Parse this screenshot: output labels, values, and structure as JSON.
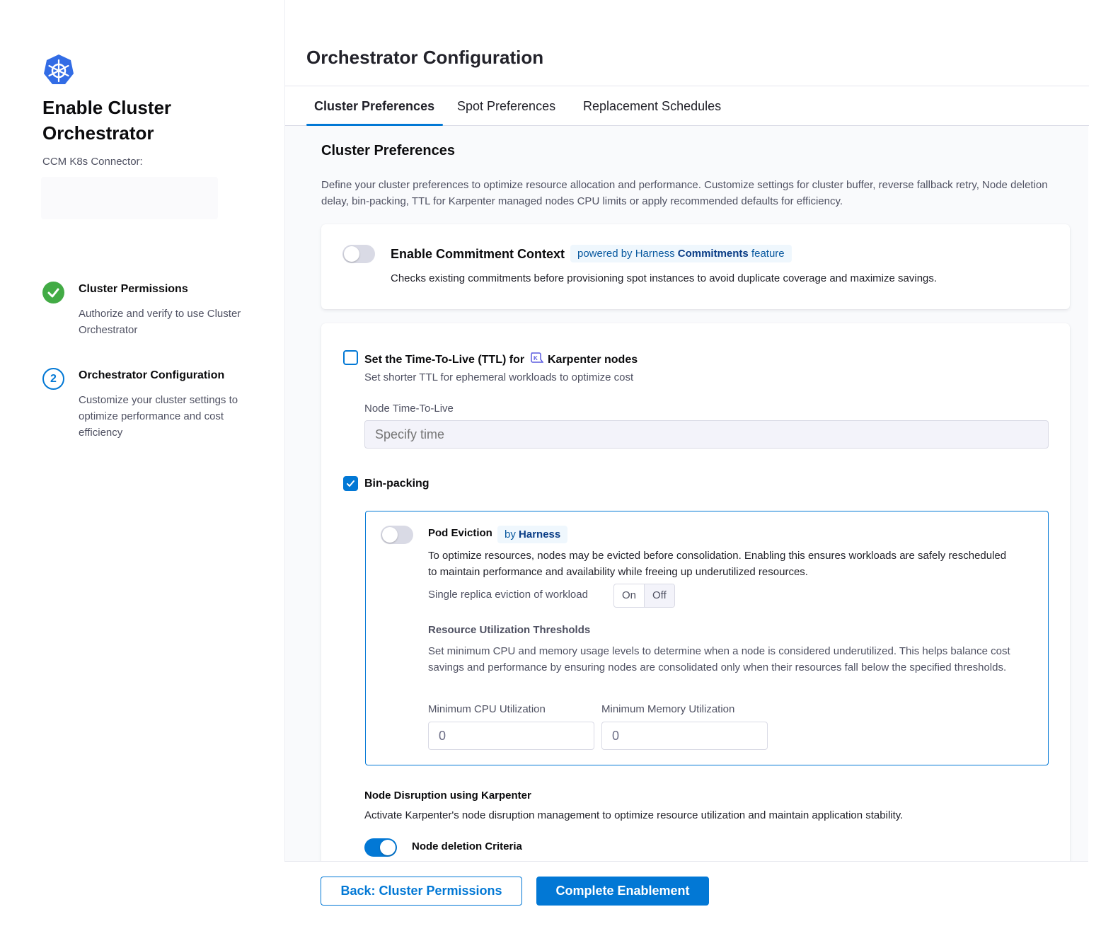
{
  "sidebar": {
    "title": "Enable Cluster Orchestrator",
    "connector_label": "CCM K8s Connector:",
    "steps": [
      {
        "number": "",
        "status": "complete",
        "title": "Cluster Permissions",
        "description": "Authorize and verify to use Cluster Orchestrator"
      },
      {
        "number": "2",
        "status": "current",
        "title": "Orchestrator Configuration",
        "description": "Customize your cluster settings to optimize performance and cost efficiency"
      }
    ]
  },
  "main": {
    "page_title": "Orchestrator Configuration",
    "tabs": [
      {
        "label": "Cluster Preferences",
        "active": true
      },
      {
        "label": "Spot Preferences",
        "active": false
      },
      {
        "label": "Replacement Schedules",
        "active": false
      }
    ],
    "section_title": "Cluster Preferences",
    "section_description": "Define your cluster preferences to optimize resource allocation and performance. Customize settings for cluster buffer, reverse fallback retry, Node deletion delay, bin-packing, TTL for Karpenter managed nodes CPU limits or apply recommended defaults for efficiency.",
    "commitment": {
      "enabled": false,
      "title": "Enable Commitment Context",
      "pill_prefix": "powered by Harness",
      "pill_bold": "Commitments",
      "pill_suffix": "feature",
      "description": "Checks existing commitments before provisioning spot instances to avoid duplicate coverage and maximize savings."
    },
    "ttl": {
      "checked": false,
      "title_prefix": "Set the Time-To-Live (TTL) for",
      "title_suffix": "Karpenter nodes",
      "description": "Set shorter TTL for ephemeral workloads to optimize cost",
      "field_label": "Node Time-To-Live",
      "placeholder": "Specify time"
    },
    "bin_packing": {
      "checked": true,
      "label": "Bin-packing",
      "pod_eviction": {
        "enabled": false,
        "title": "Pod Eviction",
        "pill_prefix": "by",
        "pill_bold": "Harness",
        "description": "To optimize resources, nodes may be evicted before consolidation. Enabling this ensures workloads are safely rescheduled to maintain performance and availability while freeing up underutilized resources.",
        "single_replica_label": "Single replica eviction of workload",
        "on_label": "On",
        "off_label": "Off",
        "selected": "Off"
      },
      "thresholds": {
        "title": "Resource Utilization Thresholds",
        "description": "Set minimum CPU and memory usage levels to determine when a node is considered underutilized. This helps balance cost savings and performance by ensuring nodes are consolidated only when their resources fall below the specified thresholds.",
        "cpu_label": "Minimum CPU Utilization",
        "cpu_value": "0",
        "memory_label": "Minimum Memory Utilization",
        "memory_value": "0"
      }
    },
    "node_disruption": {
      "title": "Node Disruption using Karpenter",
      "description": "Activate Karpenter's node disruption management to optimize resource utilization and maintain application stability.",
      "deletion_criteria_label": "Node deletion Criteria",
      "deletion_criteria_enabled": true
    }
  },
  "footer": {
    "back_label": "Back: Cluster Permissions",
    "complete_label": "Complete Enablement"
  },
  "colors": {
    "accent": "#0278d5",
    "success": "#42ab45",
    "logo": "#326ce5"
  },
  "icons": {
    "logo": "kubernetes-icon",
    "step_complete": "check-icon",
    "karpenter": "karpenter-icon"
  }
}
